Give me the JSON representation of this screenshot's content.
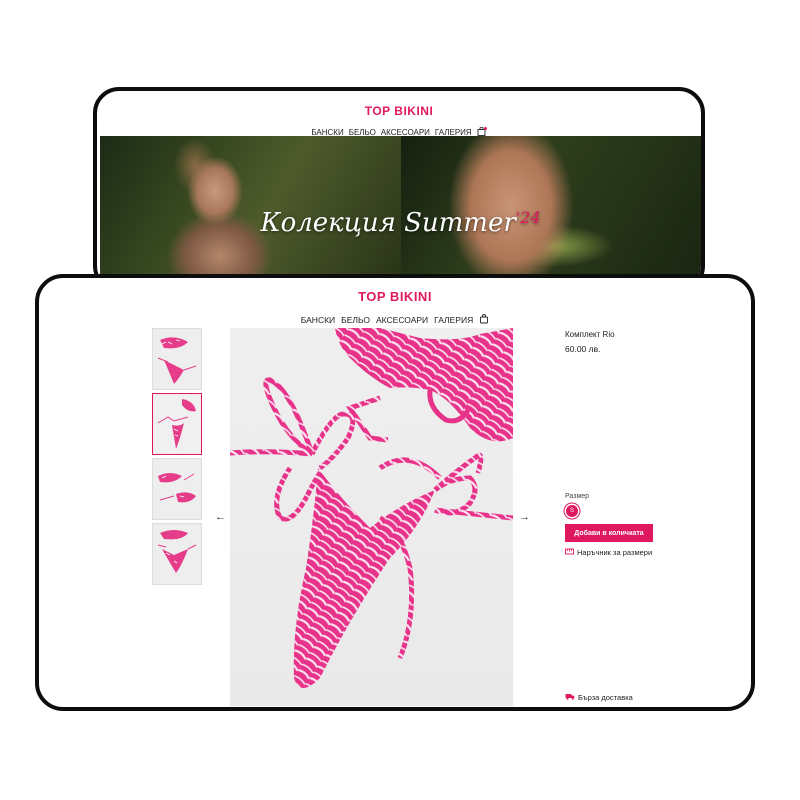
{
  "back_window": {
    "brand": "TOP BIKINI",
    "nav": [
      "БАНСКИ",
      "БЕЛЬО",
      "АКСЕСОАРИ",
      "ГАЛЕРИЯ"
    ],
    "cart_icon": "shopping-bag-icon",
    "hero": {
      "title": "Колекция Summer",
      "title_accent": "'24"
    }
  },
  "front_window": {
    "brand": "TOP BIKINI",
    "nav": [
      "БАНСКИ",
      "БЕЛЬО",
      "АКСЕСОАРИ",
      "ГАЛЕРИЯ"
    ],
    "cart_icon": "shopping-bag-icon",
    "gallery": {
      "thumbnails_count": 4,
      "active_thumbnail": 2,
      "prev_icon": "arrow-left-icon",
      "next_icon": "arrow-right-icon",
      "prev_glyph": "←",
      "next_glyph": "→"
    },
    "product": {
      "name": "Комплект Rio",
      "price": "60.00 лв.",
      "size_label": "Размер",
      "selected_size": "S",
      "add_to_cart": "Добави в количката",
      "size_guide": "Наръчник за размери",
      "size_guide_icon": "ruler-icon",
      "fast_delivery": "Бърза доставка",
      "delivery_icon": "truck-icon"
    }
  },
  "colors": {
    "accent": "#e0185f",
    "frame_border": "#0d0d0d"
  }
}
